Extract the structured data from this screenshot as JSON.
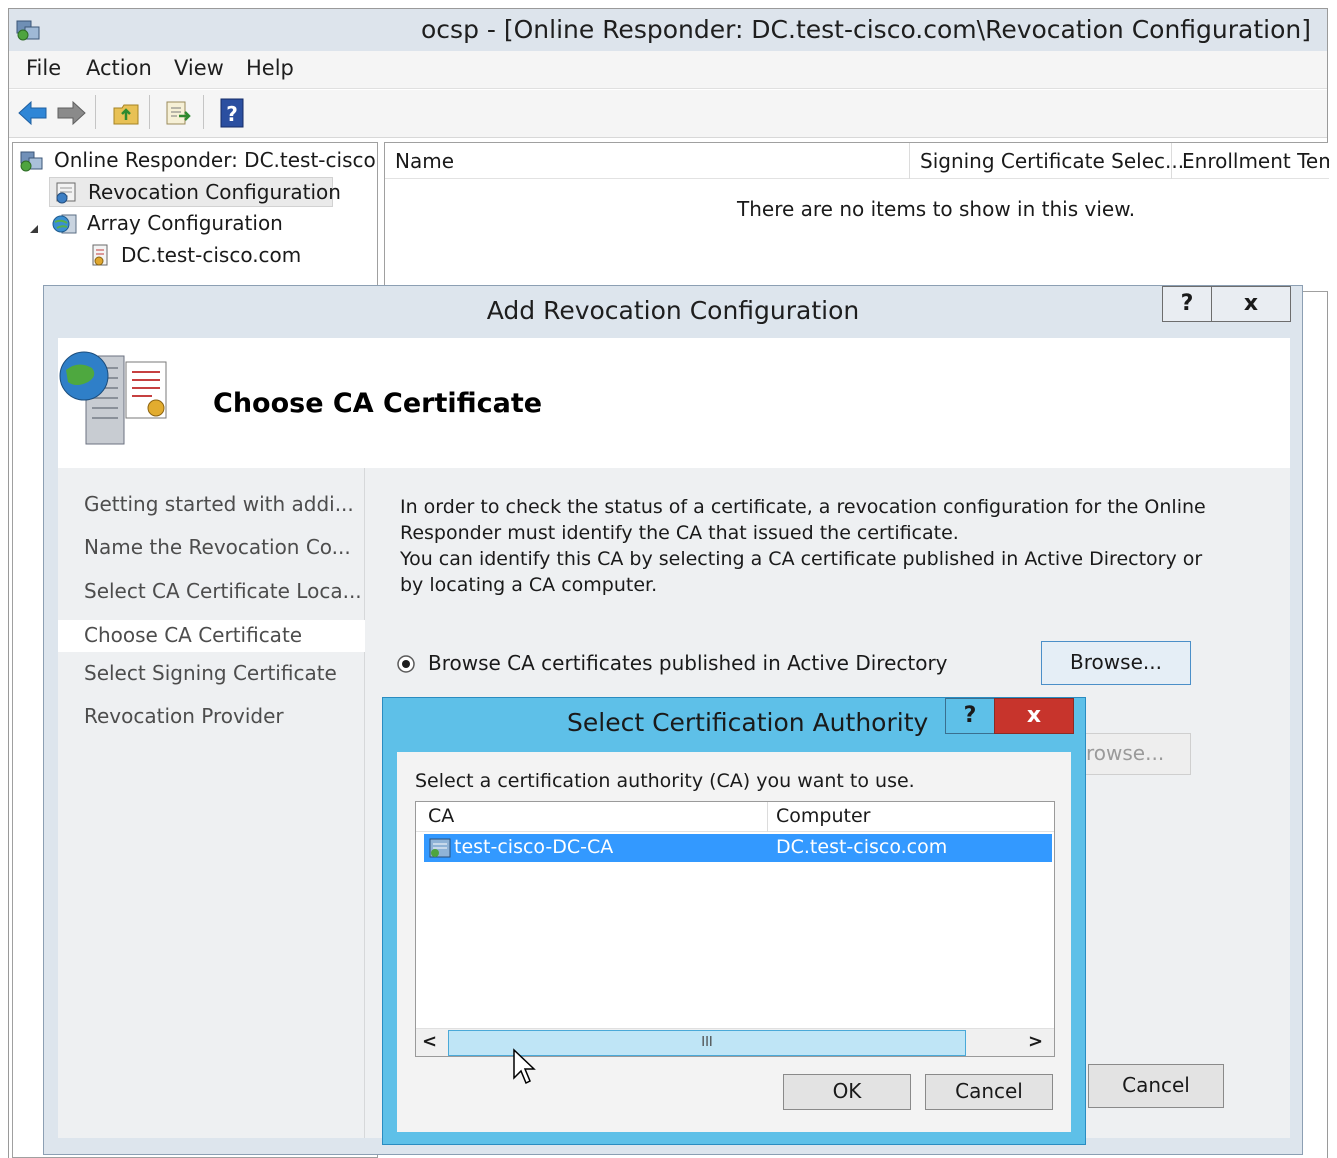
{
  "window": {
    "title": "ocsp - [Online Responder: DC.test-cisco.com\\Revocation Configuration]"
  },
  "menu": [
    "File",
    "Action",
    "View",
    "Help"
  ],
  "toolbar_icons": [
    "back-arrow-icon",
    "forward-arrow-icon",
    "up-folder-icon",
    "export-list-icon",
    "help-icon"
  ],
  "tree": {
    "root": "Online Responder: DC.test-cisco.com",
    "items": [
      {
        "label": "Revocation Configuration",
        "icon": "revocation-config-icon"
      },
      {
        "label": "Array Configuration",
        "icon": "array-globe-icon"
      },
      {
        "label": "DC.test-cisco.com",
        "icon": "server-cert-icon"
      }
    ]
  },
  "results": {
    "columns": [
      "Name",
      "Signing Certificate Selec...",
      "Enrollment Tem"
    ],
    "empty_message": "There are no items to show in this view."
  },
  "wizard": {
    "title": "Add Revocation Configuration",
    "help_button": "?",
    "close_button": "x",
    "page_title": "Choose CA Certificate",
    "nav": [
      "Getting started with addi...",
      "Name the Revocation Co...",
      "Select CA Certificate Loca...",
      "Choose CA Certificate",
      "Select Signing Certificate",
      "Revocation Provider"
    ],
    "current_step_index": 3,
    "description_lines": [
      "In order to check the status of a certificate, a revocation configuration for the Online",
      "Responder must identify the CA that issued the certificate.",
      "You can identify this CA by selecting a CA certificate published in Active Directory or",
      "by locating a CA computer."
    ],
    "radio_label": "Browse CA certificates published in Active Directory",
    "radio_selected": true,
    "browse_button": "Browse...",
    "browse_button_2_partial": "rowse...",
    "cancel_button": "Cancel"
  },
  "dialog": {
    "title": "Select Certification Authority",
    "help_button": "?",
    "close_button": "x",
    "prompt": "Select a certification authority (CA) you want to use.",
    "columns": [
      "CA",
      "Computer"
    ],
    "rows": [
      {
        "ca": "test-cisco-DC-CA",
        "computer": "DC.test-cisco.com",
        "selected": true
      }
    ],
    "scroll_left": "<",
    "scroll_right": ">",
    "scroll_grip": "III",
    "ok_button": "OK",
    "cancel_button": "Cancel"
  },
  "colors": {
    "title_bar": "#dde4ec",
    "dialog_frame": "#5ec0e8",
    "selection": "#3399ff",
    "close_red": "#c7342c"
  }
}
